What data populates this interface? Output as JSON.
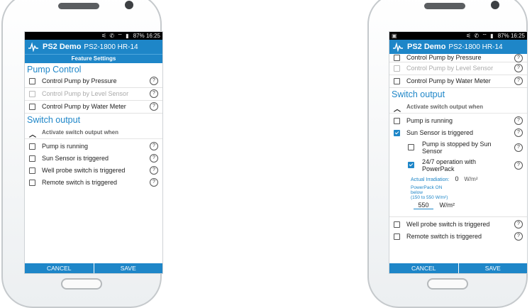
{
  "accent_color": "#1e86c8",
  "left": {
    "status_time": "16:25",
    "status_battery": "87%",
    "app_name": "PS2 Demo",
    "app_model": "PS2-1800 HR-14",
    "screen_title": "Feature Settings",
    "pump_control_heading": "Pump Control",
    "pump_items": [
      {
        "label": "Control Pump by Pressure",
        "checked": false,
        "disabled": false
      },
      {
        "label": "Control Pump by Level Sensor",
        "checked": false,
        "disabled": true
      },
      {
        "label": "Control Pump by Water Meter",
        "checked": false,
        "disabled": false
      }
    ],
    "switch_heading": "Switch output",
    "collapse_label": "Activate switch output when",
    "switch_items": [
      {
        "label": "Pump is running",
        "checked": false
      },
      {
        "label": "Sun Sensor is triggered",
        "checked": false
      },
      {
        "label": "Well probe switch is triggered",
        "checked": false
      },
      {
        "label": "Remote switch is triggered",
        "checked": false
      }
    ],
    "cancel_label": "CANCEL",
    "save_label": "SAVE"
  },
  "right": {
    "status_time": "16:25",
    "status_battery": "87%",
    "app_name": "PS2 Demo",
    "app_model": "PS2-1800 HR-14",
    "pump_items": [
      {
        "label": "Control Pump by Pressure",
        "checked": false,
        "disabled": false
      },
      {
        "label": "Control Pump by Level Sensor",
        "checked": false,
        "disabled": true
      },
      {
        "label": "Control Pump by Water Meter",
        "checked": false,
        "disabled": false
      }
    ],
    "switch_heading": "Switch output",
    "collapse_label": "Activate switch output when",
    "pump_running": {
      "label": "Pump is running",
      "checked": false
    },
    "sun_sensor": {
      "label": "Sun Sensor is triggered",
      "checked": true
    },
    "sub_pump_stopped": {
      "label": "Pump is stopped by Sun Sensor",
      "checked": false
    },
    "sub_247": {
      "label": "24/7 operation with PowerPack",
      "checked": true
    },
    "irradiation_label": "Actual Irradiation:",
    "irradiation_value": "0",
    "irradiation_unit": "W/m²",
    "powerpack_line1": "PowerPack ON",
    "powerpack_line2": "below",
    "powerpack_line3": "(150 to 550 W/m²)",
    "powerpack_value": "550",
    "powerpack_unit": "W/m²",
    "well_probe": {
      "label": "Well probe switch is triggered",
      "checked": false
    },
    "remote_switch": {
      "label": "Remote switch is triggered",
      "checked": false
    },
    "cancel_label": "CANCEL",
    "save_label": "SAVE"
  },
  "icons": {
    "help": "?",
    "chevron_up": "︿"
  }
}
